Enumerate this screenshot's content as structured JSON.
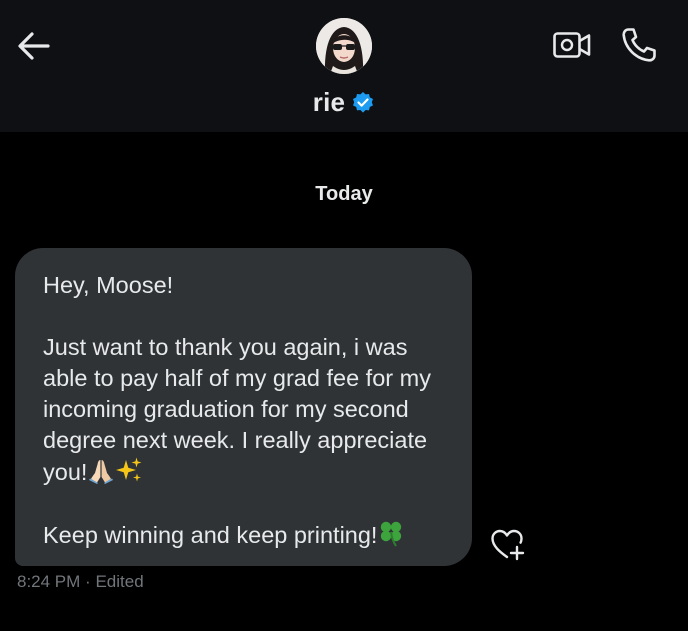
{
  "header": {
    "contact_name": "rie",
    "icons": {
      "back": "back-arrow-icon",
      "verified": "verified-badge-icon",
      "video": "video-call-icon",
      "call": "phone-icon"
    }
  },
  "conversation": {
    "date_label": "Today",
    "message": {
      "greeting": "Hey, Moose!",
      "body": "Just want to thank you again, i was able to pay half of my grad fee for my incoming graduation for my second degree next week. I really appreciate you!",
      "body_emojis": [
        "folded-hands-emoji",
        "sparkles-emoji"
      ],
      "closing": "Keep winning and keep printing!",
      "closing_emoji": "four-leaf-clover-emoji",
      "time": "8:24 PM",
      "separator": "·",
      "status": "Edited"
    },
    "reaction_icon": "add-reaction-heart-icon"
  },
  "colors": {
    "background": "#000000",
    "header_bg": "#0e1013",
    "bubble_bg": "#2f3336",
    "text": "#e7e9ea",
    "muted": "#71767b",
    "verified": "#1d9bf0"
  }
}
